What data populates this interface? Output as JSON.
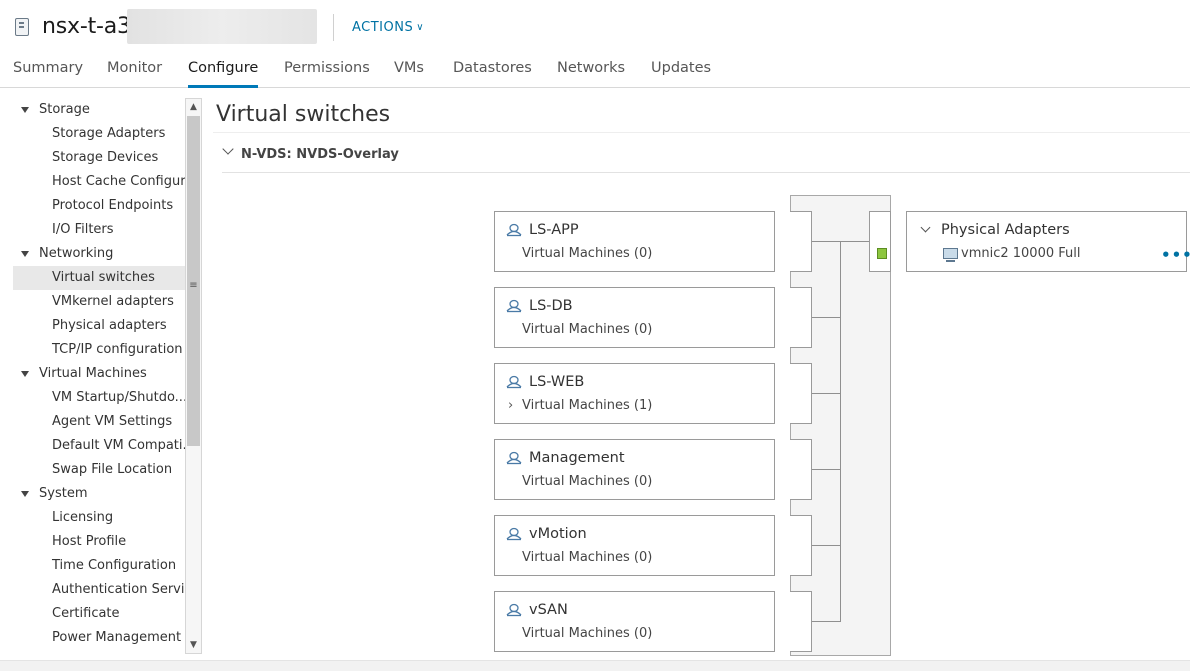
{
  "header": {
    "host_name": "nsx-t-a3",
    "actions_label": "ACTIONS"
  },
  "tabs": [
    {
      "label": "Summary"
    },
    {
      "label": "Monitor"
    },
    {
      "label": "Configure",
      "active": true
    },
    {
      "label": "Permissions"
    },
    {
      "label": "VMs"
    },
    {
      "label": "Datastores"
    },
    {
      "label": "Networks"
    },
    {
      "label": "Updates"
    }
  ],
  "nav": {
    "items": [
      {
        "label": "Storage",
        "type": "group"
      },
      {
        "label": "Storage Adapters",
        "type": "leaf"
      },
      {
        "label": "Storage Devices",
        "type": "leaf"
      },
      {
        "label": "Host Cache Configur...",
        "type": "leaf"
      },
      {
        "label": "Protocol Endpoints",
        "type": "leaf"
      },
      {
        "label": "I/O Filters",
        "type": "leaf"
      },
      {
        "label": "Networking",
        "type": "group"
      },
      {
        "label": "Virtual switches",
        "type": "leaf",
        "selected": true
      },
      {
        "label": "VMkernel adapters",
        "type": "leaf"
      },
      {
        "label": "Physical adapters",
        "type": "leaf"
      },
      {
        "label": "TCP/IP configuration",
        "type": "leaf"
      },
      {
        "label": "Virtual Machines",
        "type": "group"
      },
      {
        "label": "VM Startup/Shutdo...",
        "type": "leaf"
      },
      {
        "label": "Agent VM Settings",
        "type": "leaf"
      },
      {
        "label": "Default VM Compati...",
        "type": "leaf"
      },
      {
        "label": "Swap File Location",
        "type": "leaf"
      },
      {
        "label": "System",
        "type": "group"
      },
      {
        "label": "Licensing",
        "type": "leaf"
      },
      {
        "label": "Host Profile",
        "type": "leaf"
      },
      {
        "label": "Time Configuration",
        "type": "leaf"
      },
      {
        "label": "Authentication Servi...",
        "type": "leaf"
      },
      {
        "label": "Certificate",
        "type": "leaf"
      },
      {
        "label": "Power Management",
        "type": "leaf"
      }
    ]
  },
  "main": {
    "title": "Virtual switches",
    "switch_label": "N-VDS: NVDS-Overlay",
    "port_groups": [
      {
        "name": "LS-APP",
        "vms": "Virtual Machines (0)",
        "expandable": false
      },
      {
        "name": "LS-DB",
        "vms": "Virtual Machines (0)",
        "expandable": false
      },
      {
        "name": "LS-WEB",
        "vms": "Virtual Machines (1)",
        "expandable": true
      },
      {
        "name": "Management",
        "vms": "Virtual Machines (0)",
        "expandable": false
      },
      {
        "name": "vMotion",
        "vms": "Virtual Machines (0)",
        "expandable": false
      },
      {
        "name": "vSAN",
        "vms": "Virtual Machines (0)",
        "expandable": false
      }
    ],
    "physical_adapters": {
      "title": "Physical Adapters",
      "adapter": "vmnic2 10000 Full",
      "more_label": "•••"
    }
  },
  "colors": {
    "accent": "#0079b8",
    "link": "#0072a3",
    "uplink_port": "#8dc63f"
  }
}
